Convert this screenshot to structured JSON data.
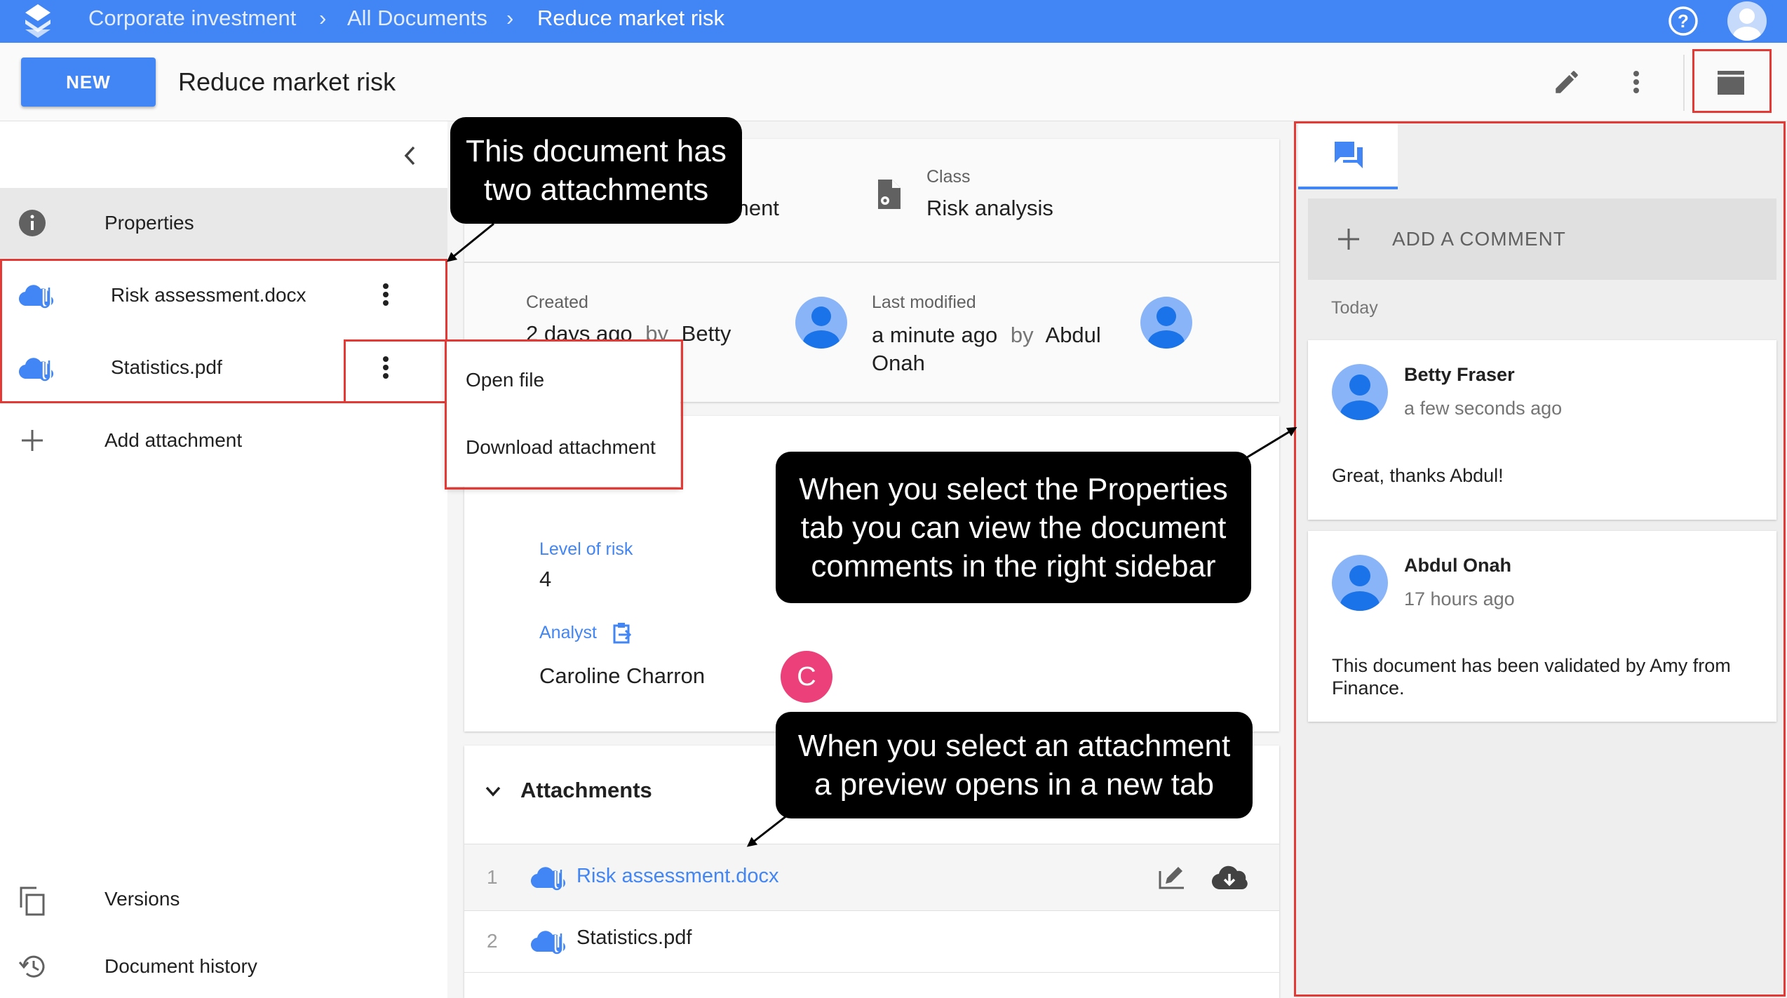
{
  "breadcrumb": {
    "items": [
      "Corporate investment",
      "All Documents",
      "Reduce market risk"
    ]
  },
  "toolbar": {
    "new_label": "NEW",
    "title": "Reduce market risk"
  },
  "left_nav": {
    "properties": "Properties",
    "attachments": [
      "Risk assessment.docx",
      "Statistics.pdf"
    ],
    "add_attachment": "Add attachment",
    "versions": "Versions",
    "document_history": "Document history"
  },
  "context_menu": {
    "open_file": "Open file",
    "download": "Download attachment"
  },
  "header_card": {
    "type_partial": "ment",
    "class_label": "Class",
    "class_value": "Risk analysis"
  },
  "meta_card": {
    "created_label": "Created",
    "created_value": "2 days ago",
    "by": "by",
    "created_by": "Betty",
    "modified_label": "Last modified",
    "modified_value": "a minute ago",
    "modified_by_line1": "Abdul",
    "modified_by_line2": "Onah"
  },
  "props_card": {
    "level_label": "Level of risk",
    "level_value": "4",
    "analyst_label": "Analyst",
    "analyst_value": "Caroline Charron",
    "analyst_initial": "C"
  },
  "attachments_card": {
    "title": "Attachments",
    "rows": [
      {
        "index": "1",
        "name": "Risk assessment.docx"
      },
      {
        "index": "2",
        "name": "Statistics.pdf"
      }
    ]
  },
  "comments": {
    "add_label": "ADD A COMMENT",
    "group": "Today",
    "items": [
      {
        "author": "Betty Fraser",
        "time": "a few seconds ago",
        "text": "Great, thanks Abdul!"
      },
      {
        "author": "Abdul Onah",
        "time": "17 hours ago",
        "text": "This document has been validated by Amy from Finance."
      }
    ]
  },
  "callouts": {
    "attachments": "This document has two attachments",
    "properties": "When you select the Properties tab you can view the document comments in the right sidebar",
    "preview": "When you select an attachment a preview opens in a new tab"
  },
  "colors": {
    "primary": "#4285f4",
    "highlight": "#e53935",
    "avatar_c": "#ec407a"
  }
}
